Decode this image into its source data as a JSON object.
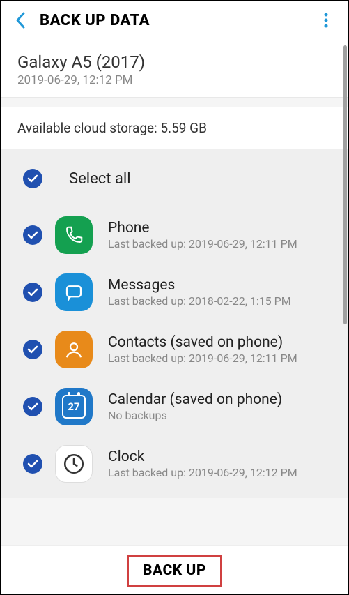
{
  "header": {
    "title": "BACK UP DATA"
  },
  "device": {
    "name": "Galaxy A5 (2017)",
    "timestamp": "2019-06-29, 12:12 PM"
  },
  "storage": {
    "label": "Available cloud storage: 5.59 GB"
  },
  "select_all": {
    "label": "Select all"
  },
  "items": [
    {
      "title": "Phone",
      "subtitle": "Last backed up: 2019-06-29, 12:11 PM",
      "icon": "phone"
    },
    {
      "title": "Messages",
      "subtitle": "Last backed up: 2018-02-22, 1:15 PM",
      "icon": "messages"
    },
    {
      "title": "Contacts (saved on phone)",
      "subtitle": "Last backed up: 2019-06-29, 12:11 PM",
      "icon": "contacts"
    },
    {
      "title": "Calendar (saved on phone)",
      "subtitle": "No backups",
      "icon": "calendar"
    },
    {
      "title": "Clock",
      "subtitle": "Last backed up: 2019-06-29, 12:12 PM",
      "icon": "clock"
    }
  ],
  "footer": {
    "button_label": "BACK UP"
  }
}
